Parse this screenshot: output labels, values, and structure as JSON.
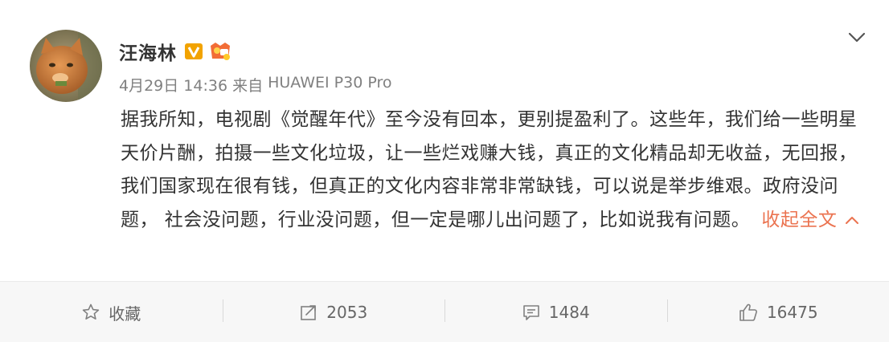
{
  "post": {
    "author": "汪海林",
    "date": "4月29日 14:36",
    "source_prefix": "来自",
    "source": "HUAWEI P30 Pro",
    "content": "据我所知，电视剧《觉醒年代》至今没有回本，更别提盈利了。这些年，我们给一些明星天价片酬，拍摄一些文化垃圾，让一些烂戏赚大钱，真正的文化精品却无收益，无回报，我们国家现在很有钱，但真正的文化内容非常非常缺钱，可以说是举步维艰。政府没问题， 社会没问题，行业没问题，但一定是哪儿出问题了，比如说我有问题。",
    "collapse_label": "收起全文",
    "icons": {
      "vip_badge": "vip-v-badge-icon",
      "level_badge": "member-level-icon",
      "dropdown": "chevron-down-icon"
    }
  },
  "actions": {
    "favorite_label": "收藏",
    "repost_count": "2053",
    "comment_count": "1484",
    "like_count": "16475"
  },
  "colors": {
    "accent": "#eb7350",
    "meta_text": "#808080",
    "body_text": "#333333",
    "action_bar_bg": "#f7f7f7"
  }
}
